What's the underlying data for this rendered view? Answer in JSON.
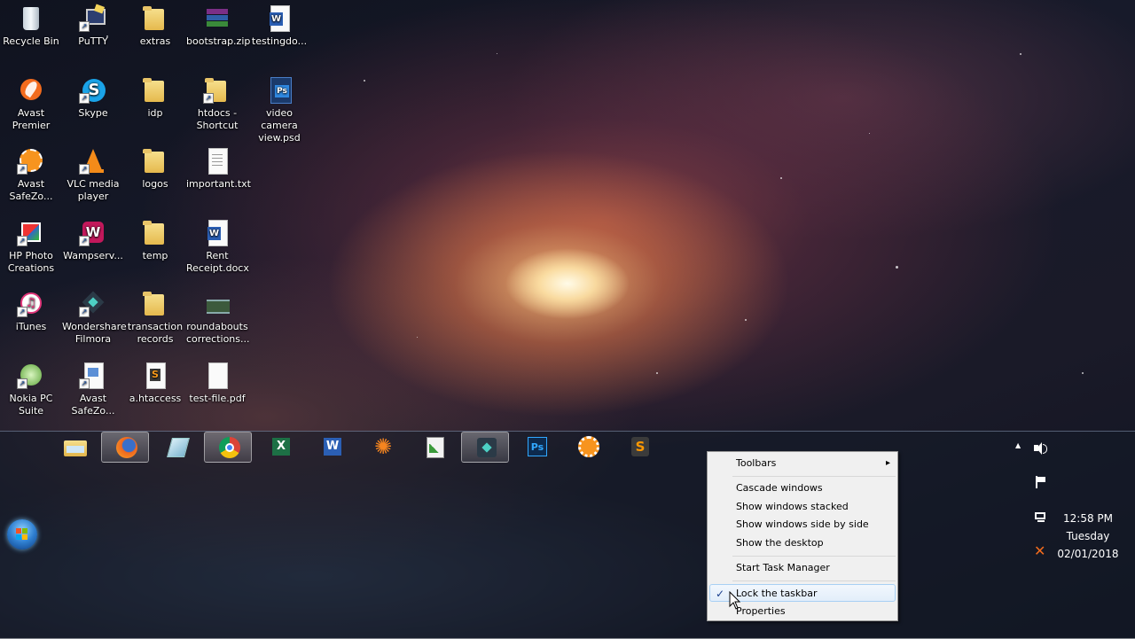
{
  "desktop_icons": [
    {
      "label": "Recycle Bin",
      "icon": "recycle-bin-icon"
    },
    {
      "label": "PuTTY",
      "icon": "putty-icon"
    },
    {
      "label": "extras",
      "icon": "folder-icon"
    },
    {
      "label": "bootstrap.zip",
      "icon": "winrar-archive-icon"
    },
    {
      "label": "testingdo...",
      "icon": "word-document-icon"
    },
    {
      "label": "Avast Premier",
      "icon": "avast-icon"
    },
    {
      "label": "Skype",
      "icon": "skype-icon"
    },
    {
      "label": "idp",
      "icon": "folder-icon"
    },
    {
      "label": "htdocs - Shortcut",
      "icon": "folder-shortcut-icon"
    },
    {
      "label": "video camera view.psd",
      "icon": "psd-file-icon"
    },
    {
      "label": "Avast SafeZo...",
      "icon": "avast-safezone-icon"
    },
    {
      "label": "VLC media player",
      "icon": "vlc-icon"
    },
    {
      "label": "logos",
      "icon": "folder-icon"
    },
    {
      "label": "important.txt",
      "icon": "text-file-icon"
    },
    {
      "label": "HP Photo Creations",
      "icon": "hp-photo-icon"
    },
    {
      "label": "Wampserv...",
      "icon": "wampserver-icon"
    },
    {
      "label": "temp",
      "icon": "folder-icon"
    },
    {
      "label": "Rent Receipt.docx",
      "icon": "word-document-icon"
    },
    {
      "label": "iTunes",
      "icon": "itunes-icon"
    },
    {
      "label": "Wondershare Filmora",
      "icon": "filmora-icon"
    },
    {
      "label": "transaction records",
      "icon": "folder-icon"
    },
    {
      "label": "roundabouts corrections...",
      "icon": "video-file-icon"
    },
    {
      "label": "Nokia PC Suite",
      "icon": "nokia-pc-suite-icon"
    },
    {
      "label": "Avast SafeZo...",
      "icon": "avast-safezone-shortcut-icon"
    },
    {
      "label": "a.htaccess",
      "icon": "sublime-file-icon"
    },
    {
      "label": "test-file.pdf",
      "icon": "pdf-file-icon"
    }
  ],
  "taskbar_items": [
    {
      "name": "file-explorer",
      "icon": "file-explorer-icon",
      "active": false
    },
    {
      "name": "firefox",
      "icon": "firefox-icon",
      "active": true
    },
    {
      "name": "unknown-app",
      "icon": "glass-app-icon",
      "active": false
    },
    {
      "name": "chrome",
      "icon": "chrome-icon",
      "active": true
    },
    {
      "name": "excel",
      "icon": "excel-icon",
      "active": false
    },
    {
      "name": "word",
      "icon": "word-icon",
      "active": false
    },
    {
      "name": "burst-app",
      "icon": "burst-icon",
      "active": false
    },
    {
      "name": "chart-app",
      "icon": "chart-icon",
      "active": false
    },
    {
      "name": "filmora",
      "icon": "filmora-icon",
      "active": true
    },
    {
      "name": "photoshop",
      "icon": "photoshop-icon",
      "active": false
    },
    {
      "name": "avast-safezone",
      "icon": "avast-safezone-icon",
      "active": false
    },
    {
      "name": "sublime-text",
      "icon": "sublime-icon",
      "active": false
    }
  ],
  "context_menu": {
    "items": [
      {
        "label": "Toolbars",
        "submenu": true
      },
      {
        "label": "Cascade windows"
      },
      {
        "label": "Show windows stacked"
      },
      {
        "label": "Show windows side by side"
      },
      {
        "label": "Show the desktop"
      },
      {
        "label": "Start Task Manager"
      },
      {
        "label": "Lock the taskbar",
        "checked": true,
        "highlighted": true
      },
      {
        "label": "Properties"
      }
    ],
    "check_mark": "✓",
    "submenu_arrow": "▸"
  },
  "clock": {
    "time": "12:58 PM",
    "day": "Tuesday",
    "date": "02/01/2018"
  },
  "tray": {
    "show_hidden_arrow": "▲"
  }
}
